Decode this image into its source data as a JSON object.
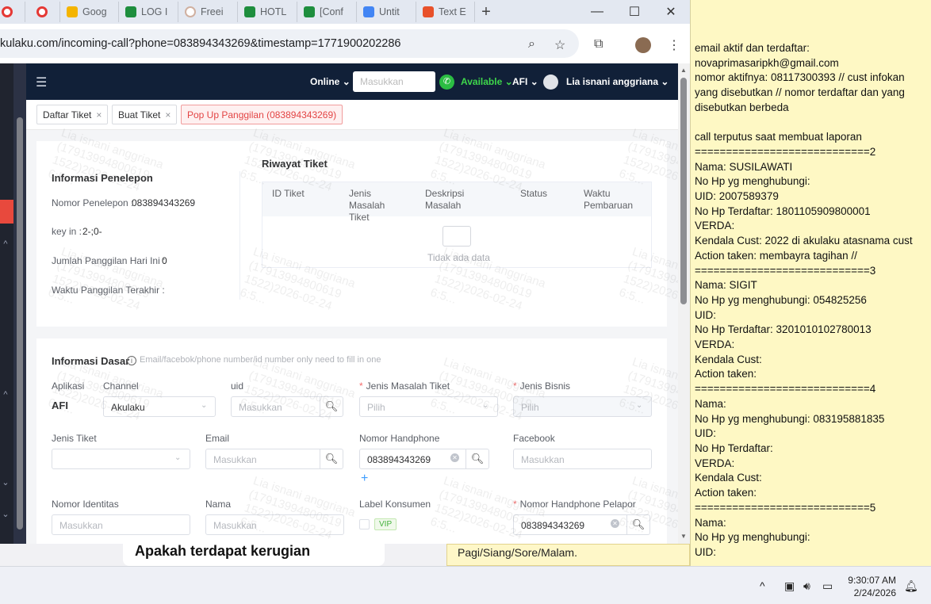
{
  "browser": {
    "tabs": [
      {
        "label": "",
        "icon": "red"
      },
      {
        "label": "",
        "icon": "red"
      },
      {
        "label": "Goog",
        "icon": "yel"
      },
      {
        "label": "LOG I",
        "icon": "grn"
      },
      {
        "label": "Freei",
        "icon": "grey"
      },
      {
        "label": "HOTL",
        "icon": "grn"
      },
      {
        "label": "[Conf",
        "icon": "grn"
      },
      {
        "label": "Untit",
        "icon": "doc"
      },
      {
        "label": "Text E",
        "icon": "txt"
      }
    ],
    "new_tab": "+",
    "minimize": "—",
    "maximize": "☐",
    "close": "✕",
    "url": "kulaku.com/incoming-call?phone=083894343269&timestamp=1771900202286"
  },
  "app": {
    "header": {
      "menu_icon": "☰",
      "status": "Online",
      "search_placeholder": "Masukkan",
      "agent_status": "Available",
      "company": "AFI",
      "user": "Lia isnani anggriana"
    },
    "tags": [
      {
        "label": "Daftar Tiket",
        "close": "×"
      },
      {
        "label": "Buat Tiket",
        "close": "×"
      },
      {
        "label": "Pop Up Panggilan (083894343269)",
        "close": ""
      }
    ],
    "caller": {
      "title": "Informasi Penelepon",
      "phone_label": "Nomor Penelepon :",
      "phone_value": "083894343269",
      "key_label": "key in :",
      "key_value": "2-;0-",
      "calls_label": "Jumlah Panggilan Hari Ini :",
      "calls_value": "0",
      "last_label": "Waktu Panggilan Terakhir :",
      "last_value": ""
    },
    "history": {
      "title": "Riwayat Tiket",
      "columns": [
        "ID Tiket",
        "Jenis Masalah Tiket",
        "Deskripsi Masalah",
        "Status",
        "Waktu Pembaruan"
      ],
      "empty": "Tidak ada data"
    },
    "basic": {
      "title": "Informasi Dasar",
      "hint": "Email/facebok/phone number/id number only need to fill in one",
      "app_label": "Aplikasi",
      "app_value": "AFI",
      "channel_label": "Channel",
      "channel_value": "Akulaku",
      "uid_label": "uid",
      "uid_placeholder": "Masukkan",
      "issue_label": "Jenis Masalah Tiket",
      "issue_placeholder": "Pilih",
      "business_label": "Jenis Bisnis",
      "business_placeholder": "Pilih",
      "ticket_type_label": "Jenis Tiket",
      "email_label": "Email",
      "email_placeholder": "Masukkan",
      "hp_label": "Nomor Handphone",
      "hp_value": "083894343269",
      "add": "+",
      "facebook_label": "Facebook",
      "facebook_placeholder": "Masukkan",
      "id_label": "Nomor Identitas",
      "id_placeholder": "Masukkan",
      "name_label": "Nama",
      "name_placeholder": "Masukkan",
      "consumer_label": "Label Konsumen",
      "vip": "VIP",
      "reporter_label": "Nomor Handphone Pelapor",
      "reporter_value": "083894343269"
    },
    "watermark": "Lia isnani anggriana\n(17913994800619\n1522)2026-02-24\n6:5..."
  },
  "behind": {
    "left_text": "Apakah terdapat kerugian",
    "right_text": "Pagi/Siang/Sore/Malam."
  },
  "notepad": {
    "text": "email aktif dan terdaftar:\nnovaprimasaripkh@gmail.com\nnomor aktifnya: 08117300393 // cust infokan\nyang disebutkan // nomor terdaftar dan yang\ndisebutkan berbeda\n\ncall terputus saat membuat laporan\n============================2\nNama: SUSILAWATI\nNo Hp yg menghubungi:\nUID: 2007589379\nNo Hp Terdaftar: 1801105909800001\nVERDA:\nKendala Cust: 2022 di akulaku atasnama cust\nAction taken: membayra tagihan //\n============================3\nNama: SIGIT\nNo Hp yg menghubungi: 054825256\nUID:\nNo Hp Terdaftar: 3201010102780013\nVERDA:\nKendala Cust:\nAction taken:\n============================4\nNama:\nNo Hp yg menghubungi: 083195881835\nUID:\nNo Hp Terdaftar:\nVERDA:\nKendala Cust:\nAction taken:\n============================5\nNama:\nNo Hp yg menghubungi:\nUID:"
  },
  "taskbar": {
    "time": "9:30:07 AM",
    "date": "2/24/2026"
  }
}
